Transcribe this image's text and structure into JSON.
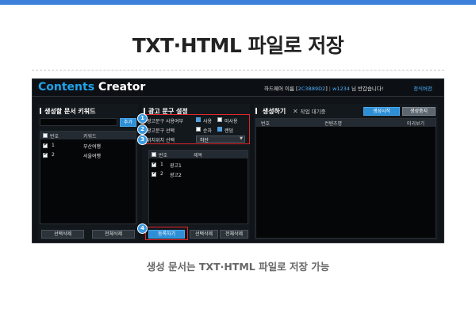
{
  "slide": {
    "title": "TXT·HTML 파일로 저장",
    "caption": "생성 문서는 TXT·HTML 파일로 저장 가능"
  },
  "colors": {
    "accent": "#3d7fd9",
    "app_bg": "#101418",
    "highlight": "#e2262a",
    "badge": "#3a9be2"
  },
  "app": {
    "logo_word1": "Contents",
    "logo_word2": "Creator",
    "user_prefix": "하드웨어 이름 [",
    "user_id": "2C3B89D2",
    "user_mid": "]",
    "user_name": "w1234",
    "user_greeting": "님 반갑습니다!",
    "pay_link": "정식버전"
  },
  "keyword_panel": {
    "title": "생성할 문서 키워드",
    "add_button": "추가",
    "columns": [
      "번호",
      "키워드"
    ],
    "rows": [
      {
        "no": "1",
        "keyword": "부산여행",
        "checked": true
      },
      {
        "no": "2",
        "keyword": "서울여행",
        "checked": true
      }
    ],
    "delete_selected": "선택삭제",
    "delete_all": "전체삭제"
  },
  "ad_panel": {
    "title": "광고 문구 설정",
    "rows": [
      {
        "label": "광고문구 사용여부",
        "opt1": "사용",
        "opt1_on": true,
        "opt2": "미사용",
        "opt2_on": false
      },
      {
        "label": "광고문구 선택",
        "opt1": "순차",
        "opt1_on": false,
        "opt2": "랜덤",
        "opt2_on": true
      },
      {
        "label": "위치위치 선택",
        "select_value": "하단"
      }
    ],
    "list_columns": [
      "번호",
      "제목"
    ],
    "list_rows": [
      {
        "no": "1",
        "title": "광고1",
        "checked": true
      },
      {
        "no": "2",
        "title": "광고2",
        "checked": true
      }
    ],
    "register": "등록하기",
    "delete_selected": "선택삭제",
    "delete_all": "전체삭제"
  },
  "generate_panel": {
    "title": "생성하기",
    "status": "작업 대기중",
    "start_button": "생성시작",
    "stop_button": "생성중지",
    "columns": [
      "번호",
      "컨텐츠명",
      "미리보기"
    ]
  },
  "markers": [
    "1",
    "2",
    "3",
    "4"
  ]
}
